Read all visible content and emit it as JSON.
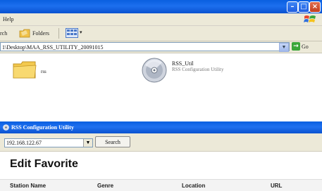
{
  "explorer": {
    "menubar": {
      "help_label": "Help"
    },
    "toolbar": {
      "search_label": "rch",
      "folders_label": "Folders",
      "views_arrow": "▾"
    },
    "address": {
      "path": "1\\Desktop\\MAA_RSS_UTILITY_20091015",
      "go_label": "Go"
    },
    "items": [
      {
        "icon": "folder-icon",
        "label": "rss"
      },
      {
        "icon": "cd-icon",
        "name": "RSS_Util",
        "description": "RSS Configuration Utility"
      }
    ]
  },
  "rss_window": {
    "title": "RSS Configuration Utility",
    "ip_value": "192.168.122.67",
    "search_label": "Search",
    "heading": "Edit Favorite",
    "columns": [
      "Station Name",
      "Genre",
      "Location",
      "URL"
    ]
  }
}
